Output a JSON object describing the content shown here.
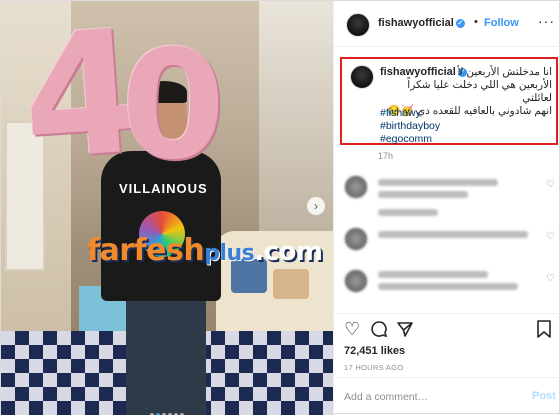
{
  "post": {
    "username": "fishawyofficial",
    "follow_label": "Follow",
    "separator": "•",
    "more_icon": "more-options-icon",
    "photo": {
      "balloon_digits": [
        "4",
        "0"
      ],
      "shirt_text": "VILLAINOUS",
      "next_icon": "chevron-right-icon",
      "carousel_dots": 6,
      "active_dot": 1
    },
    "watermark": {
      "brand": "farfesh",
      "plus": "plus",
      ".tld": ".com"
    },
    "caption": {
      "lines": [
        "انا مدخلتش الأربعين لأ",
        "الأربعين هي اللي دخلت عليا شكراً لعائلتي",
        "انهم شادوني بالعافيه للقعده دي 🥳😥"
      ],
      "hashtags": [
        "#fishawy",
        "#birthdayboy",
        "#egocomm"
      ],
      "age": "17h"
    },
    "likes": "72,451 likes",
    "timestamp": "17 HOURS AGO",
    "comment_input": {
      "placeholder": "Add a comment…"
    },
    "post_label": "Post",
    "colors": {
      "accent": "#3897f0",
      "highlight_border": "#e02020",
      "hashtag": "#003569",
      "muted": "#8e8e8e"
    },
    "icons": [
      "heart-icon",
      "comment-icon",
      "share-icon",
      "bookmark-icon",
      "verified-badge-icon"
    ]
  }
}
